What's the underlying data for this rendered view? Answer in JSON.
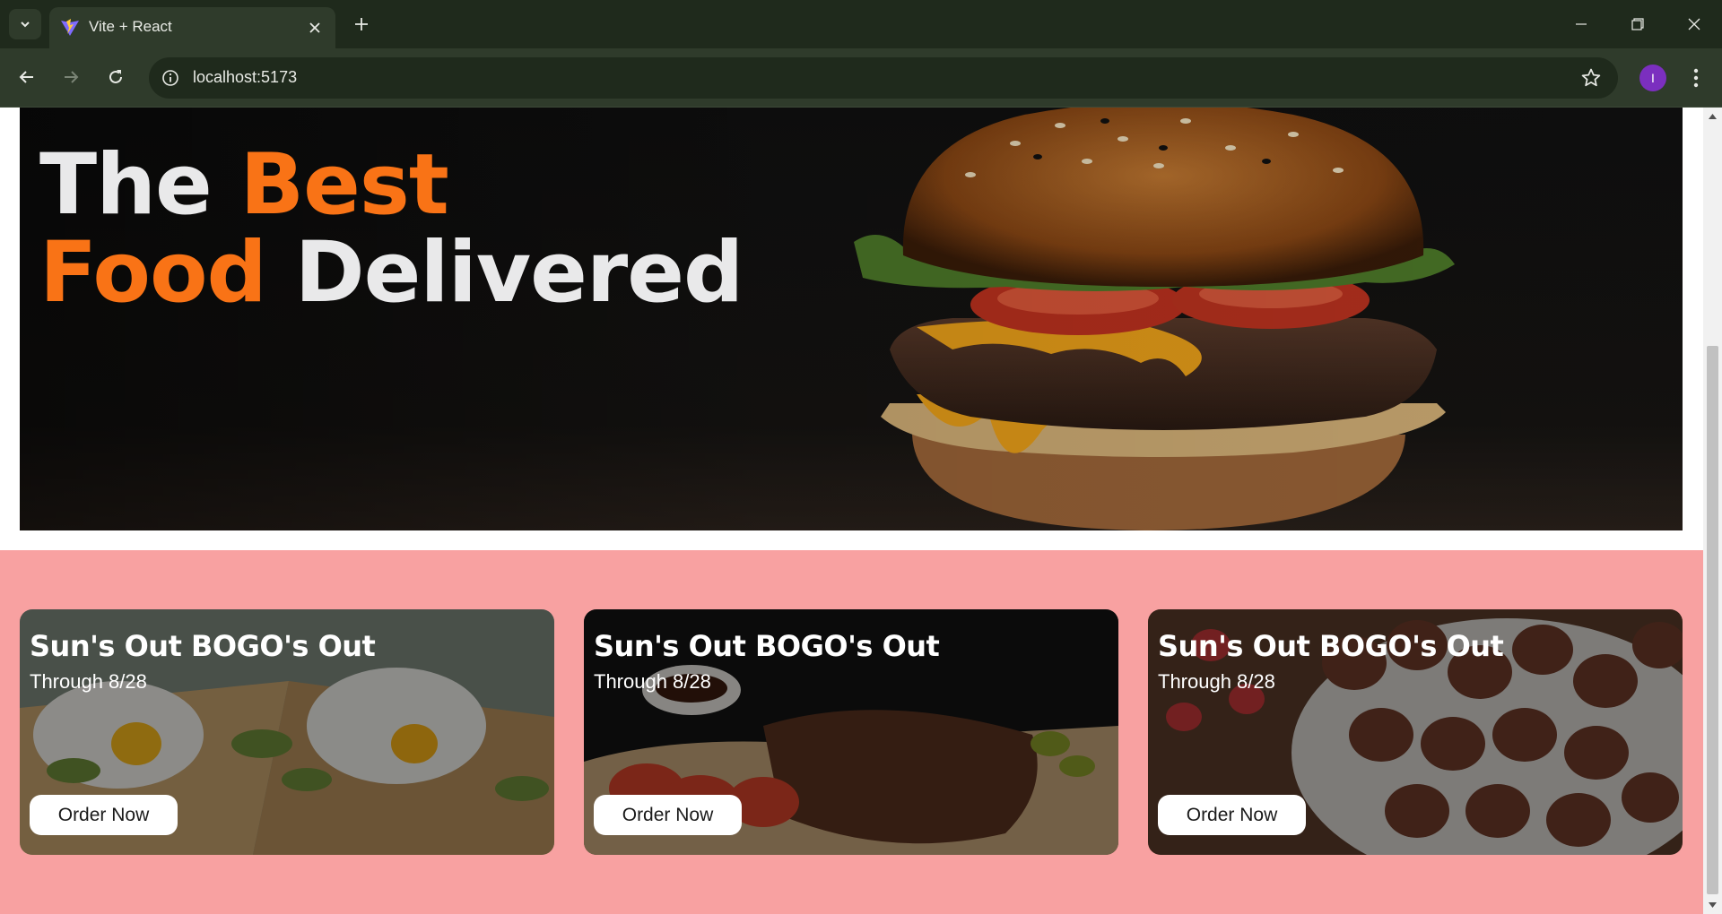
{
  "browser": {
    "tab_title": "Vite + React",
    "url": "localhost:5173",
    "profile_initial": "I"
  },
  "hero": {
    "line1_word1": "The",
    "line1_word2": "Best",
    "line2_word1": "Food",
    "line2_word2": "Delivered",
    "accent_color": "#f97316"
  },
  "promos": [
    {
      "title": "Sun's Out BOGO's Out",
      "subtitle": "Through 8/28",
      "button": "Order Now"
    },
    {
      "title": "Sun's Out BOGO's Out",
      "subtitle": "Through 8/28",
      "button": "Order Now"
    },
    {
      "title": "Sun's Out BOGO's Out",
      "subtitle": "Through 8/28",
      "button": "Order Now"
    }
  ],
  "colors": {
    "promo_background": "#f8a1a1",
    "chrome_dark": "#1f2a1c",
    "chrome_light": "#2f3b2b"
  },
  "icons": {
    "tab_menu": "chevron-down-icon",
    "close": "close-icon",
    "new_tab": "plus-icon",
    "back": "arrow-left-icon",
    "forward": "arrow-right-icon",
    "reload": "reload-icon",
    "site_info": "info-icon",
    "bookmark": "star-icon",
    "menu": "kebab-icon"
  }
}
